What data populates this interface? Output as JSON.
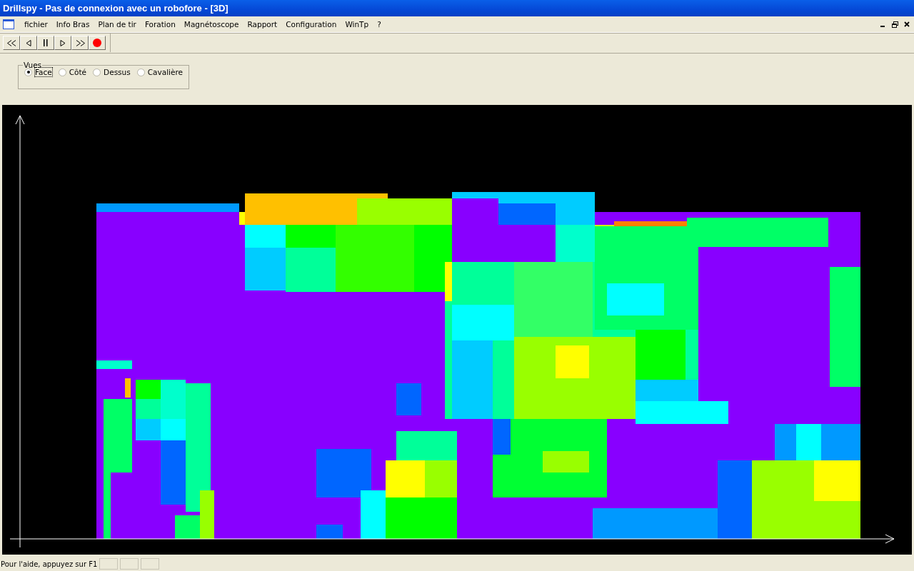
{
  "window": {
    "title": "Drillspy - Pas de connexion avec un robofore - [3D]"
  },
  "menu": [
    "fichier",
    "Info Bras",
    "Plan de tir",
    "Foration",
    "Magnétoscope",
    "Rapport",
    "Configuration",
    "WinTp",
    "?"
  ],
  "views": {
    "legend": "Vues",
    "options": [
      {
        "label": "Face",
        "selected": true
      },
      {
        "label": "Côté",
        "selected": false
      },
      {
        "label": "Dessus",
        "selected": false
      },
      {
        "label": "Cavalière",
        "selected": false
      }
    ]
  },
  "status_bar": {
    "text": "Pour l'aide, appuyez sur F1"
  }
}
